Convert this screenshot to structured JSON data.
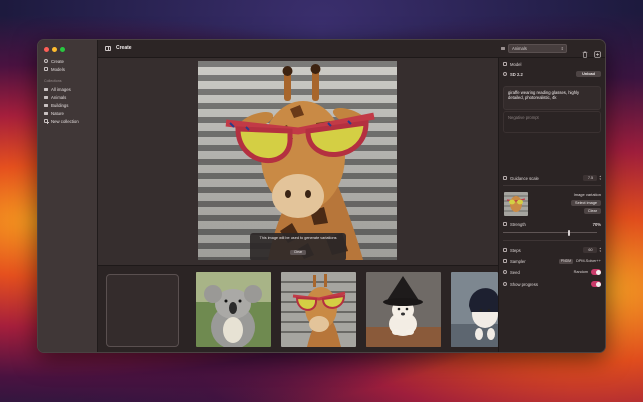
{
  "window": {
    "toolbar_title": "Create",
    "collection_selected": "Animals",
    "colors": {
      "accent": "#c93b6a",
      "window_bg": "#2e2727",
      "sidebar_bg": "#403737"
    }
  },
  "sidebar": {
    "top_items": [
      {
        "label": "Create",
        "icon": "sparkle-icon"
      },
      {
        "label": "Models",
        "icon": "cube-icon"
      }
    ],
    "group_label": "Collections",
    "collections": [
      {
        "label": "All images",
        "icon": "folder-icon"
      },
      {
        "label": "Animals",
        "icon": "folder-icon"
      },
      {
        "label": "Buildings",
        "icon": "folder-icon"
      },
      {
        "label": "Nature",
        "icon": "folder-icon"
      }
    ],
    "new_collection_label": "New collection"
  },
  "canvas": {
    "main_image_subject": "giraffe",
    "tooltip_text": "This image will be used to generate variations",
    "tooltip_button": "Clear"
  },
  "filmstrip": {
    "thumbnails": [
      "koala",
      "giraffe",
      "dog-witch-hat",
      "dog-hood"
    ]
  },
  "inspector": {
    "model_header": "Model",
    "model_name": "SD 2.2",
    "unload_button": "Unload",
    "prompt": "giraffe wearing reading glasses, highly detailed, photorealistic, 4k",
    "negative_prompt_placeholder": "Negative prompt",
    "guidance_label": "Guidance scale",
    "guidance_value": "7.5",
    "variation_label": "Image variation",
    "select_image_button": "Select image",
    "clear_button": "Clear",
    "strength_label": "Strength",
    "strength_value": "70%",
    "strength_fraction": 0.7,
    "steps_label": "Steps",
    "steps_value": "60",
    "sampler_label": "Sampler",
    "sampler_chip": "PNDM",
    "sampler_value": "DPM-Solver++",
    "seed_label": "Seed",
    "seed_value": "Random",
    "show_progress_label": "Show progress"
  }
}
